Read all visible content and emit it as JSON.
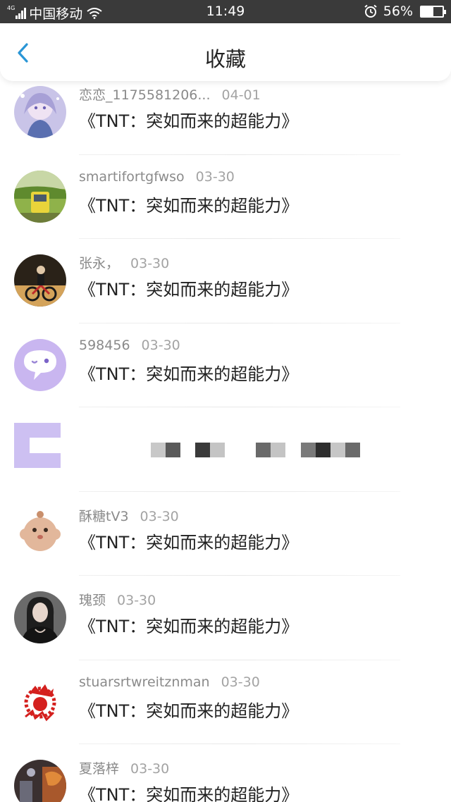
{
  "status_bar": {
    "network_tag": "4G",
    "carrier": "中国移动",
    "time": "11:49",
    "battery_percent": "56%",
    "battery_level": 0.56
  },
  "header": {
    "title": "收藏",
    "back_icon": "chevron-left-icon"
  },
  "colors": {
    "accent": "#2a96d6",
    "status_bar_bg": "#3a3a3a"
  },
  "favorites": [
    {
      "user": "恋恋_1175581206...",
      "date": "04-01",
      "book": "《TNT：突如而来的超能力》"
    },
    {
      "user": "smartifortgfwso",
      "date": "03-30",
      "book": "《TNT：突如而来的超能力》"
    },
    {
      "user": "张永，",
      "date": "03-30",
      "book": "《TNT：突如而来的超能力》"
    },
    {
      "user": "598456",
      "date": "03-30",
      "book": "《TNT：突如而来的超能力》"
    },
    {
      "user": "",
      "date": "",
      "book": ""
    },
    {
      "user": "酥糖tV3",
      "date": "03-30",
      "book": "《TNT：突如而来的超能力》"
    },
    {
      "user": "瑰颈",
      "date": "03-30",
      "book": "《TNT：突如而来的超能力》"
    },
    {
      "user": "stuarsrtwreitznman",
      "date": "03-30",
      "book": "《TNT：突如而来的超能力》"
    },
    {
      "user": "夏落梓",
      "date": "03-30",
      "book": "《TNT：突如而来的超能力》"
    }
  ]
}
